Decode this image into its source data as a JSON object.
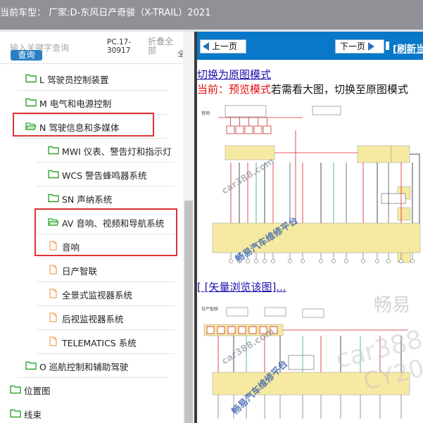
{
  "header": {
    "title": "当前车型：  厂家:D-东风日产奇骏（X-TRAIL）2021"
  },
  "left_panel": {
    "search_placeholder": "输入关键字查询",
    "search_button": "查询",
    "pc_code": "PC.17-30917",
    "collapse_all": "折叠全部",
    "all_button": "全",
    "tree": [
      {
        "label": "L 驾驶员控制装置",
        "type": "folder"
      },
      {
        "label": "M 电气和电源控制",
        "type": "folder"
      },
      {
        "label": "N 驾驶信息和多媒体",
        "type": "folder-open"
      },
      {
        "label": "MWI 仪表、警告灯和指示灯",
        "type": "folder"
      },
      {
        "label": "WCS 警告蜂鸣器系统",
        "type": "folder"
      },
      {
        "label": "SN 声纳系统",
        "type": "folder"
      },
      {
        "label": "AV 音响、视频和导航系统",
        "type": "folder-open"
      },
      {
        "label": "音响",
        "type": "page"
      },
      {
        "label": "日产智联",
        "type": "page"
      },
      {
        "label": "全景式监视器系统",
        "type": "page"
      },
      {
        "label": "后视监视器系统",
        "type": "page"
      },
      {
        "label": "TELEMATICS 系统",
        "type": "page"
      },
      {
        "label": "O 巡航控制和辅助驾驶",
        "type": "folder"
      },
      {
        "label": "位置图",
        "type": "folder"
      },
      {
        "label": "线束",
        "type": "folder"
      }
    ]
  },
  "right_panel": {
    "prev_button": "上一页",
    "next_button": "下一页",
    "refresh_link": "[刷新当",
    "original_mode_link": "切换为原图模式",
    "current_mode_prefix": "当前：预览模式",
    "current_mode_suffix": "若需看大图，切换至原图模式",
    "vector_link": "[ [矢量浏览该图]...",
    "diagram1_title": "音响",
    "diagram2_title": "日产智联"
  },
  "watermark": {
    "site": "car388.com",
    "platform": "畅易汽车维修平台",
    "brand": "畅易",
    "site_partial": "car388.",
    "code_partial": "CY20"
  },
  "colors": {
    "title_bar": "#8f9196",
    "nav_bar": "#0a78c8",
    "folder_green": "#2fa52f",
    "page_orange": "#f0a45a",
    "highlight_red": "#d33333"
  }
}
